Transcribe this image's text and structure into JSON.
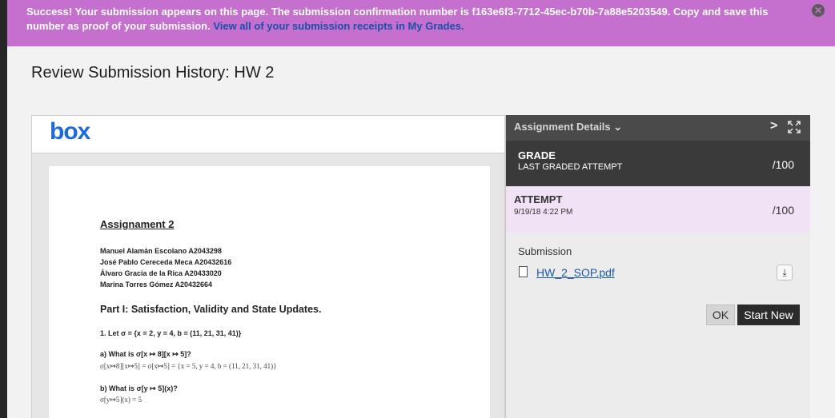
{
  "banner": {
    "message": "Success! Your submission appears on this page. The submission confirmation number is f163e6f3-7712-45ec-b70b-7a88e5203549. Copy and save this number as proof of your submission.",
    "link": "View all of your submission receipts in My Grades.",
    "close_icon": "✕"
  },
  "page": {
    "title": "Review Submission History: HW 2"
  },
  "viewer": {
    "logo": "box",
    "document": {
      "heading": "Assignament 2",
      "authors": [
        "Manuel Alamán Escolano A2043298",
        "José Pablo Cereceda Meca A20432616",
        "Álvaro Gracia de la Rica A20433020",
        "Marina Torres Gómez A20432664"
      ],
      "part": "Part I: Satisfaction, Validity and State Updates.",
      "q1": "1. Let σ = {x = 2, y = 4, b = (11, 21, 31, 41)}",
      "qa": "a) What is σ[x ↦ 8][x ↦ 5]?",
      "qa_ans": "σ[x↦8][x↦5] = σ[x↦5] = {x = 5,  y = 4,  b = (11, 21, 31, 41)}",
      "qb": "b) What is σ[y ↦ 5](x)?",
      "qb_ans": "σ[y↦5](x) = 5"
    }
  },
  "panel": {
    "header_title": "Assignment Details",
    "header_caret": "⌄",
    "nav_chevron": ">",
    "grade": {
      "label": "GRADE",
      "sublabel": "LAST GRADED ATTEMPT",
      "value": "/100"
    },
    "attempt": {
      "label": "ATTEMPT",
      "date": "9/19/18 4:22 PM",
      "value": "/100"
    },
    "submission_label": "Submission",
    "file_name": "HW_2_SOP.pdf",
    "download_icon": "⤓",
    "ok_label": "OK",
    "start_new_label": "Start New"
  }
}
